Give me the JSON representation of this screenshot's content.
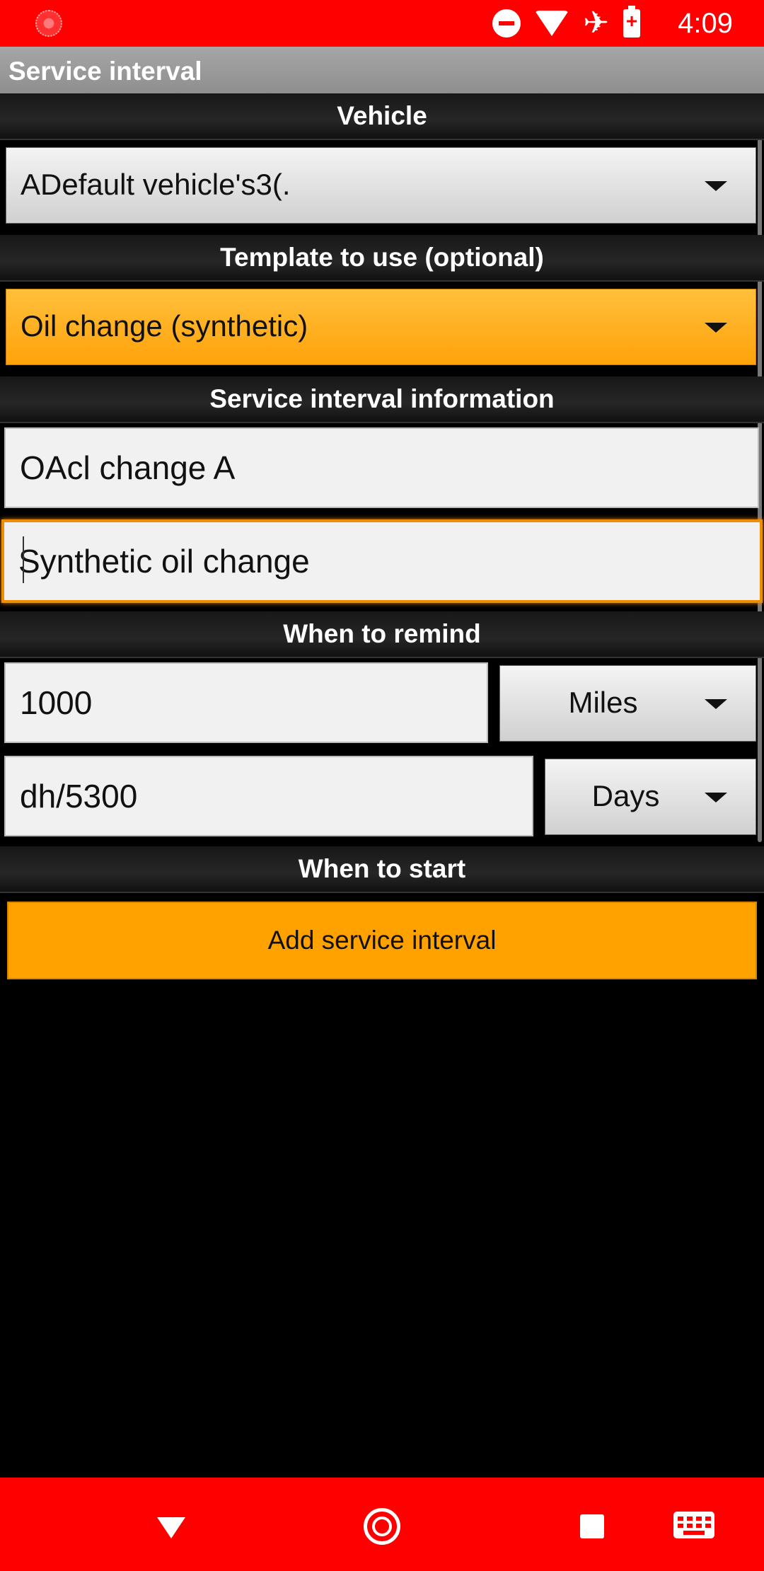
{
  "status_bar": {
    "time": "4:09"
  },
  "app_bar": {
    "title": "Service interval"
  },
  "sections": {
    "vehicle": "Vehicle",
    "template": "Template to use (optional)",
    "info": "Service interval information",
    "remind": "When to remind",
    "start": "When to start"
  },
  "vehicle_spinner": {
    "value": "ADefault vehicle's3(."
  },
  "template_spinner": {
    "value": "Oil change (synthetic)",
    "accent": "#ffa200"
  },
  "info_fields": {
    "name": "OAcl change A",
    "description": "Synthetic oil change"
  },
  "remind": {
    "distance_value": "1000",
    "distance_unit": "Miles",
    "time_value": "dh/5300",
    "time_unit": "Days"
  },
  "add_button": {
    "label": "Add service interval"
  },
  "colors": {
    "status_bar": "#ff0000",
    "accent": "#ffa200",
    "background": "#000000"
  }
}
